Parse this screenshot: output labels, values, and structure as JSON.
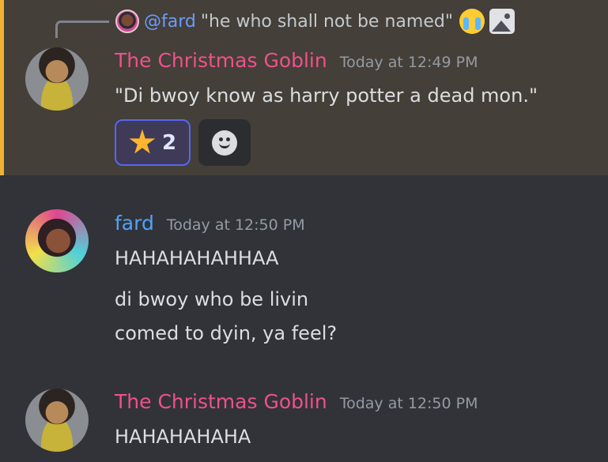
{
  "reply": {
    "mention": "@fard",
    "quote": "\"he who shall not be named\""
  },
  "messages": [
    {
      "username": "The Christmas Goblin",
      "timestamp": "Today at 12:49 PM",
      "lines": [
        "\"Di bwoy know as harry potter a dead mon.\""
      ],
      "reactions": [
        {
          "emoji": "star",
          "count": "2"
        }
      ]
    },
    {
      "username": "fard",
      "timestamp": "Today at 12:50 PM",
      "lines": [
        "HAHAHAHAHHAA",
        "di bwoy who be livin",
        "comed to dyin, ya feel?"
      ]
    },
    {
      "username": "The Christmas Goblin",
      "timestamp": "Today at 12:50 PM",
      "lines": [
        "HAHAHAHAHA"
      ]
    }
  ],
  "colors": {
    "background": "#313338",
    "highlight": "#443f38",
    "highlight_bar": "#f0b232",
    "goblin_name": "#f0508c",
    "fard_name": "#4fa3ff",
    "mention": "#6c9bff"
  }
}
